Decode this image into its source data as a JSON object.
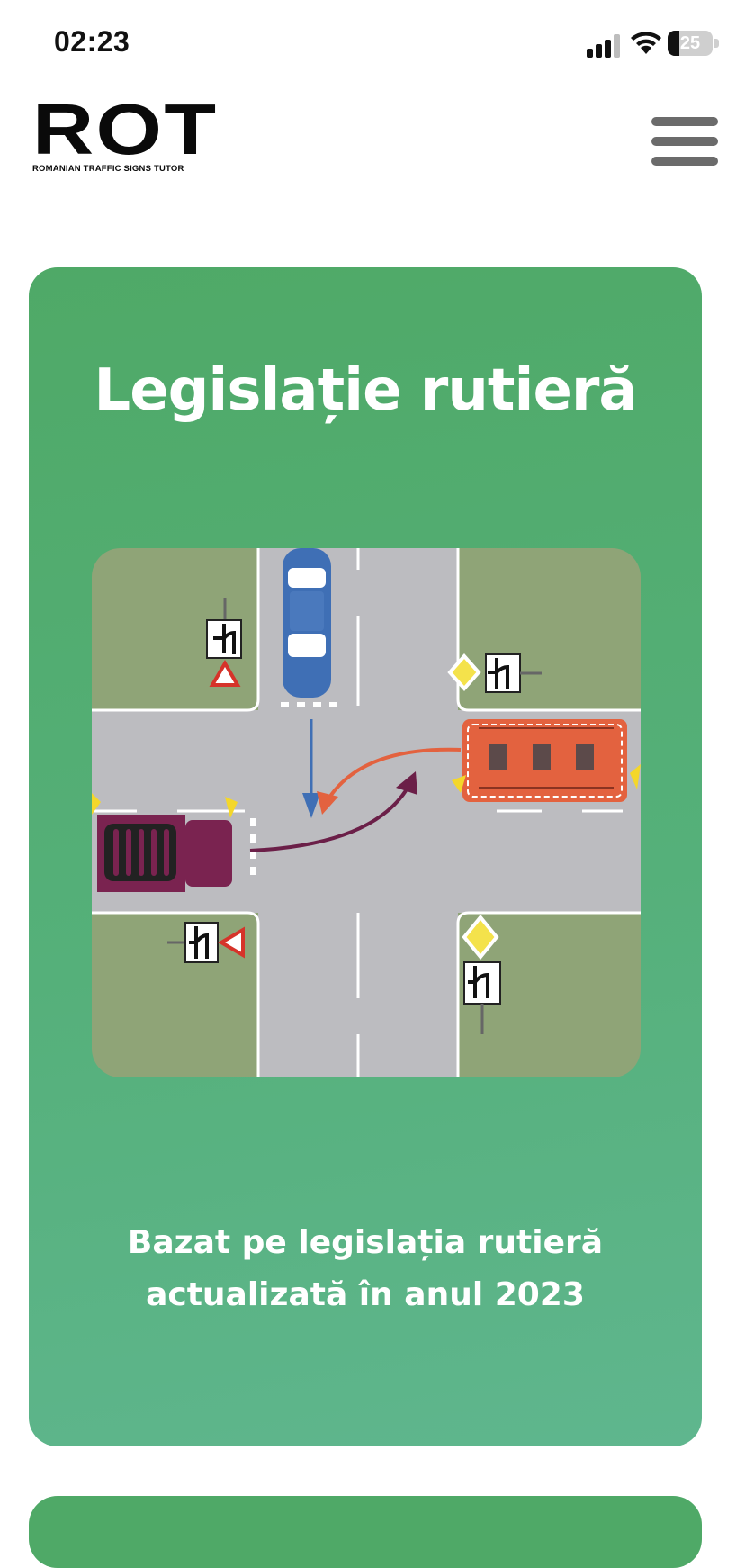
{
  "status_bar": {
    "time": "02:23",
    "battery_level": "25",
    "battery_fraction": 0.25,
    "icons": [
      "cellular-signal-icon",
      "wifi-icon",
      "battery-icon"
    ]
  },
  "header": {
    "logo_text": "ROT",
    "logo_subtitle": "ROMANIAN TRAFFIC SIGNS TUTOR",
    "menu_icon": "hamburger-menu-icon"
  },
  "hero": {
    "title": "Legislație rutieră",
    "subtitle_line1": "Bazat pe legislația rutieră",
    "subtitle_line2": "actualizată în anul 2023",
    "illustration": "intersection-priority-illustration"
  },
  "colors": {
    "card_green": "#4fa967",
    "road_gray": "#bcbcc0",
    "grass": "#8fa477",
    "car_blue": "#3f6fb5",
    "truck_maroon": "#7a2350",
    "bus_orange": "#e3623f"
  }
}
